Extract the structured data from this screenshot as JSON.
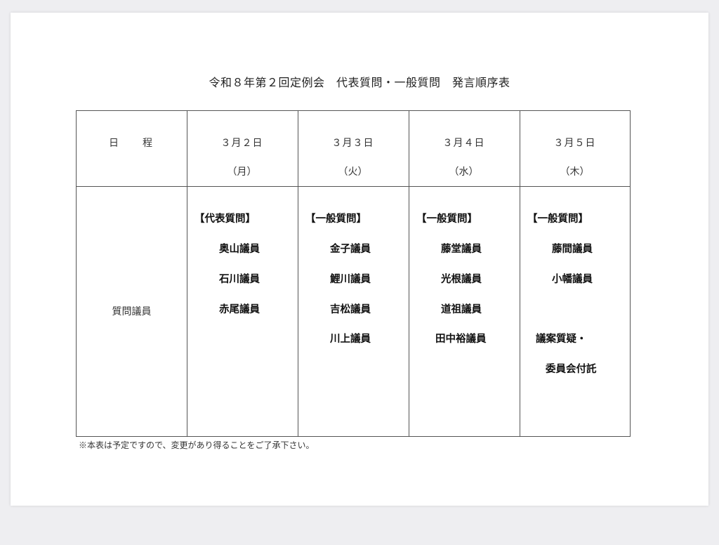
{
  "title": "令和８年第２回定例会　代表質問・一般質問　発言順序表",
  "header_label": "日　　程",
  "row_label": "質問議員",
  "days": [
    {
      "date": "３月２日",
      "weekday": "（月）",
      "category": "【代表質問】",
      "members": [
        "奥山議員",
        "石川議員",
        "赤尾議員"
      ],
      "extra": []
    },
    {
      "date": "３月３日",
      "weekday": "（火）",
      "category": "【一般質問】",
      "members": [
        "金子議員",
        "鯉川議員",
        "吉松議員",
        "川上議員"
      ],
      "extra": []
    },
    {
      "date": "３月４日",
      "weekday": "（水）",
      "category": "【一般質問】",
      "members": [
        "藤堂議員",
        "光根議員",
        "道祖議員",
        "田中裕議員"
      ],
      "extra": []
    },
    {
      "date": "３月５日",
      "weekday": "（木）",
      "category": "【一般質問】",
      "members": [
        "藤間議員",
        "小幡議員"
      ],
      "extra": [
        "議案質疑・",
        "委員会付託"
      ]
    }
  ],
  "note": "※本表は予定ですので、変更があり得ることをご了承下さい。"
}
